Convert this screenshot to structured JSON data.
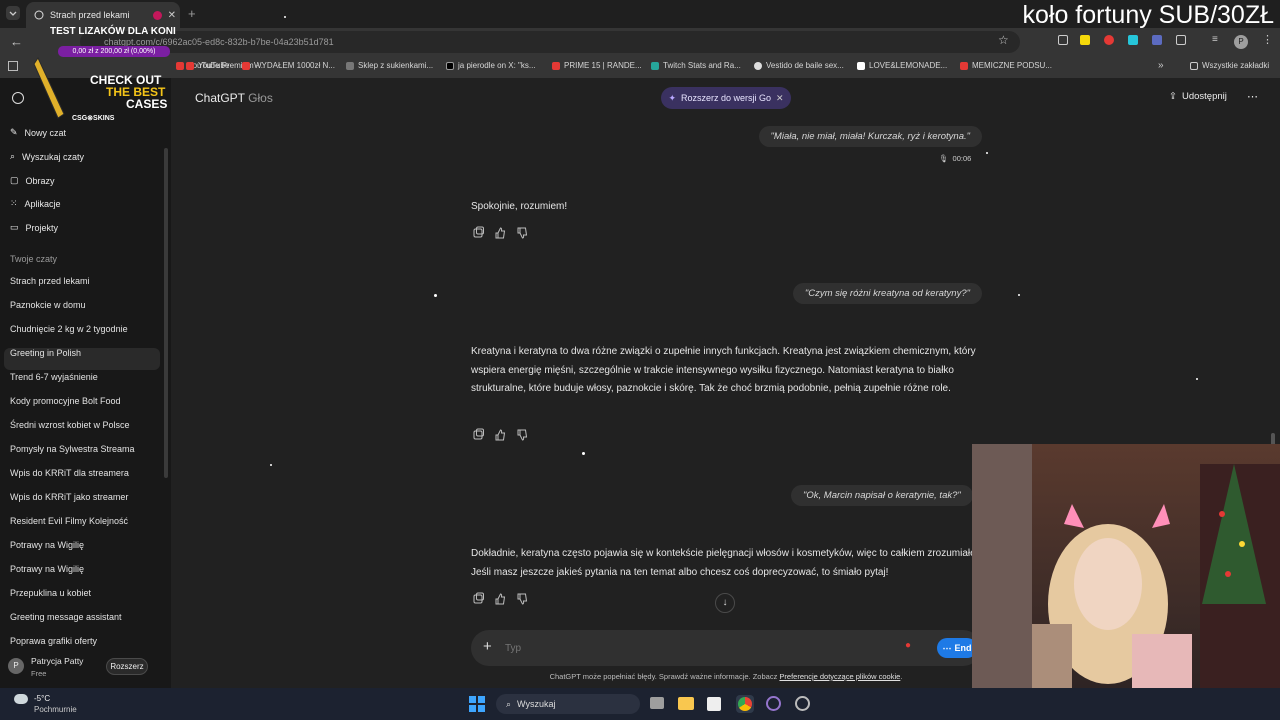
{
  "browser": {
    "tab_title": "Strach przed lekami",
    "url": "chatgpt.com/c/6962ac05-ed8c-832b-b7be-04a23b51d781",
    "bookmarks": [
      "YouTube Premium -...",
      "YouTube",
      "WYDAŁEM 1000zł N...",
      "Sklep z sukienkami...",
      "ja pierodle on X: \"ks...",
      "PRIME 15 | RANDE...",
      "Twitch Stats and Ra...",
      "Vestido de baile sex...",
      "LOVE&LEMONADE...",
      "MEMICZNE PODSU..."
    ],
    "all_bookmarks": "Wszystkie zakładki"
  },
  "overlay": {
    "wheel_text": "koło fortuny SUB/30ZŁ",
    "promo_title": "TEST LIZAKÓW DLA KONI",
    "promo_amount": "0,00 zł z 200,00 zł (0,00%)",
    "promo_cta": "CHECK OUT",
    "promo_cta2": "THE BEST",
    "promo_cta3": "CASES",
    "promo_brand": "CSG⊗SKINS"
  },
  "sidebar": {
    "nav": [
      {
        "label": "Nowy czat",
        "icon": "edit-icon"
      },
      {
        "label": "Wyszukaj czaty",
        "icon": "search-icon"
      },
      {
        "label": "Obrazy",
        "icon": "image-icon"
      },
      {
        "label": "Aplikacje",
        "icon": "apps-icon"
      },
      {
        "label": "Projekty",
        "icon": "folder-icon"
      }
    ],
    "section_title": "Twoje czaty",
    "chats": [
      "Strach przed lekami",
      "Paznokcie w domu",
      "Chudnięcie 2 kg w 2 tygodnie",
      "Greeting in Polish",
      "Trend 6-7 wyjaśnienie",
      "Kody promocyjne Bolt Food",
      "Średni wzrost kobiet w Polsce",
      "Pomysły na Sylwestra Streama",
      "Wpis do KRRiT dla streamera",
      "Wpis do KRRiT jako streamer",
      "Resident Evil Filmy Kolejność",
      "Potrawy na Wigilię",
      "Potrawy na Wigilię",
      "Przepuklina u kobiet",
      "Greeting message assistant",
      "Poprawa grafiki oferty"
    ],
    "user_name": "Patrycja Patty",
    "user_plan": "Free",
    "user_initial": "P",
    "upgrade_label": "Rozszerz"
  },
  "header": {
    "title": "ChatGPT",
    "title_suffix": "Głos",
    "upgrade_pill": "Rozszerz do wersji Go",
    "share_label": "Udostępnij"
  },
  "conversation": {
    "user1": "\"Miała, nie miał, miała! Kurczak, ryż i kerotyna.\"",
    "user1_duration": "00:06",
    "assistant1": "Spokojnie, rozumiem!",
    "user2": "\"Czym się różni kreatyna od keratyny?\"",
    "assistant2": "Kreatyna i keratyna to dwa różne związki o zupełnie innych funkcjach. Kreatyna jest związkiem chemicznym, który wspiera energię mięśni, szczególnie w trakcie intensywnego wysiłku fizycznego. Natomiast keratyna to białko strukturalne, które buduje włosy, paznokcie i skórę. Tak że choć brzmią podobnie, pełnią zupełnie różne role.",
    "user3": "\"Ok, Marcin napisał o keratynie, tak?\"",
    "assistant3": "Dokładnie, keratyna często pojawia się w kontekście pielęgnacji włosów i kosmetyków, więc to całkiem zrozumiałe. Jeśli masz jeszcze jakieś pytania na ten temat albo chcesz coś doprecyzować, to śmiało pytaj!"
  },
  "composer": {
    "placeholder": "Typ",
    "end_label": "End"
  },
  "footer": {
    "disclaimer": "ChatGPT może popełniać błędy. Sprawdź ważne informacje. Zobacz",
    "link": "Preferencje dotyczące plików cookie",
    "period": "."
  },
  "taskbar": {
    "weather_temp": "-5°C",
    "weather_desc": "Pochmurnie",
    "search_placeholder": "Wyszukaj"
  },
  "colors": {
    "accent_blue": "#1e7ae6",
    "pill_purple": "#3a3160"
  }
}
